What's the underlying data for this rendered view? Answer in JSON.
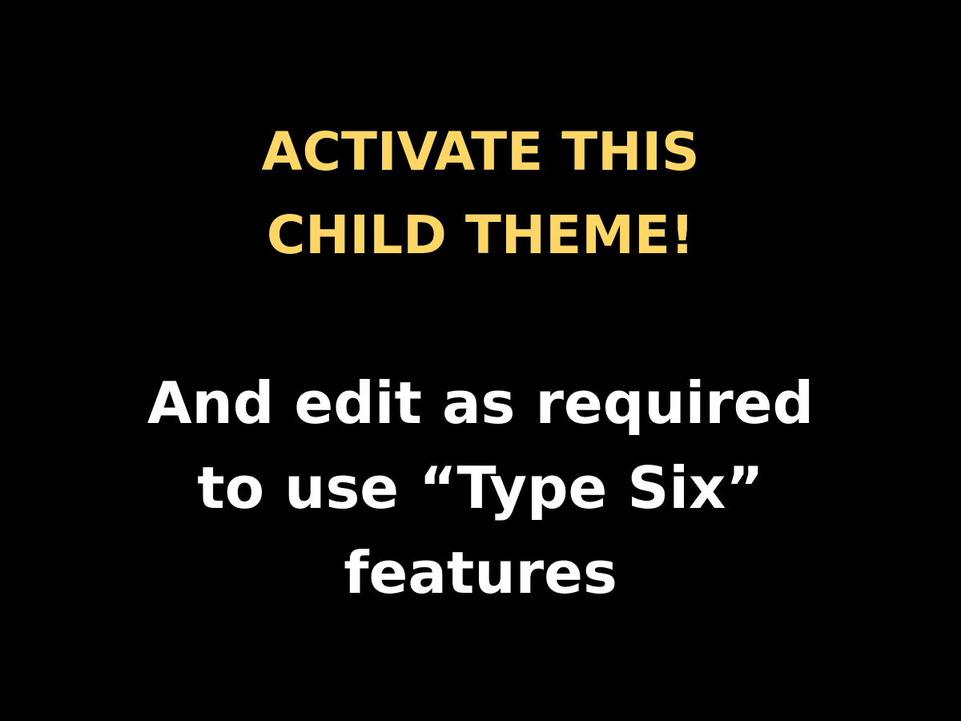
{
  "slide": {
    "background_color": "#000000",
    "headline": {
      "color": "#fdd666",
      "lines": [
        "ACTIVATE THIS",
        "CHILD THEME!"
      ]
    },
    "body": {
      "color": "#ffffff",
      "lines": [
        "And edit as required",
        "to use “Type Six”",
        "features"
      ]
    }
  }
}
